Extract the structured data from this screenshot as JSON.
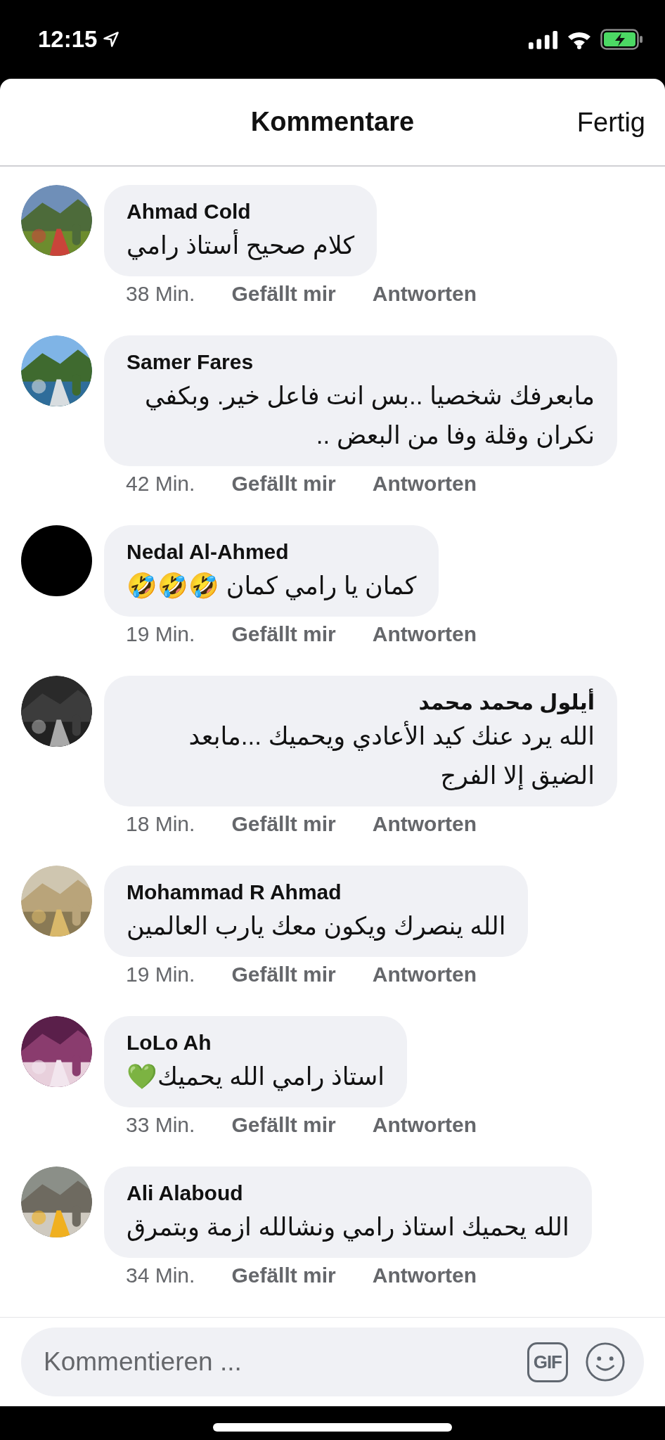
{
  "status_bar": {
    "time": "12:15"
  },
  "header": {
    "title": "Kommentare",
    "done": "Fertig"
  },
  "comments": [
    {
      "author": "Ahmad Cold",
      "text": "كلام صحيح أستاذ رامي",
      "time": "38 Min.",
      "like": "Gefällt mir",
      "reply": "Antworten"
    },
    {
      "author": "Samer Fares",
      "text": "مابعرفك شخصيا ..بس انت فاعل خير.  وبكفي نكران وقلة وفا من البعض ..",
      "time": "42 Min.",
      "like": "Gefällt mir",
      "reply": "Antworten"
    },
    {
      "author": "Nedal Al-Ahmed",
      "text": "كمان يا رامي كمان 🤣🤣🤣",
      "time": "19 Min.",
      "like": "Gefällt mir",
      "reply": "Antworten",
      "avatar": {
        "kind": "blank"
      }
    },
    {
      "author": "أيلول محمد محمد",
      "text": "الله يرد عنك كيد الأعادي ويحميك ...مابعد الضيق إلا الفرج",
      "time": "18 Min.",
      "like": "Gefällt mir",
      "reply": "Antworten"
    },
    {
      "author": "Mohammad R Ahmad",
      "text": "الله ينصرك ويكون معك يارب العالمين",
      "time": "19 Min.",
      "like": "Gefällt mir",
      "reply": "Antworten"
    },
    {
      "author": "LoLo Ah",
      "text": "استاذ رامي الله يحميك💚",
      "time": "33 Min.",
      "like": "Gefällt mir",
      "reply": "Antworten"
    },
    {
      "author": "Ali Alaboud",
      "text": "الله يحميك استاذ رامي  ونشالله ازمة وبتمرق",
      "time": "34 Min.",
      "like": "Gefällt mir",
      "reply": "Antworten"
    }
  ],
  "composer": {
    "placeholder": "Kommentieren ...",
    "gif": "GIF"
  }
}
